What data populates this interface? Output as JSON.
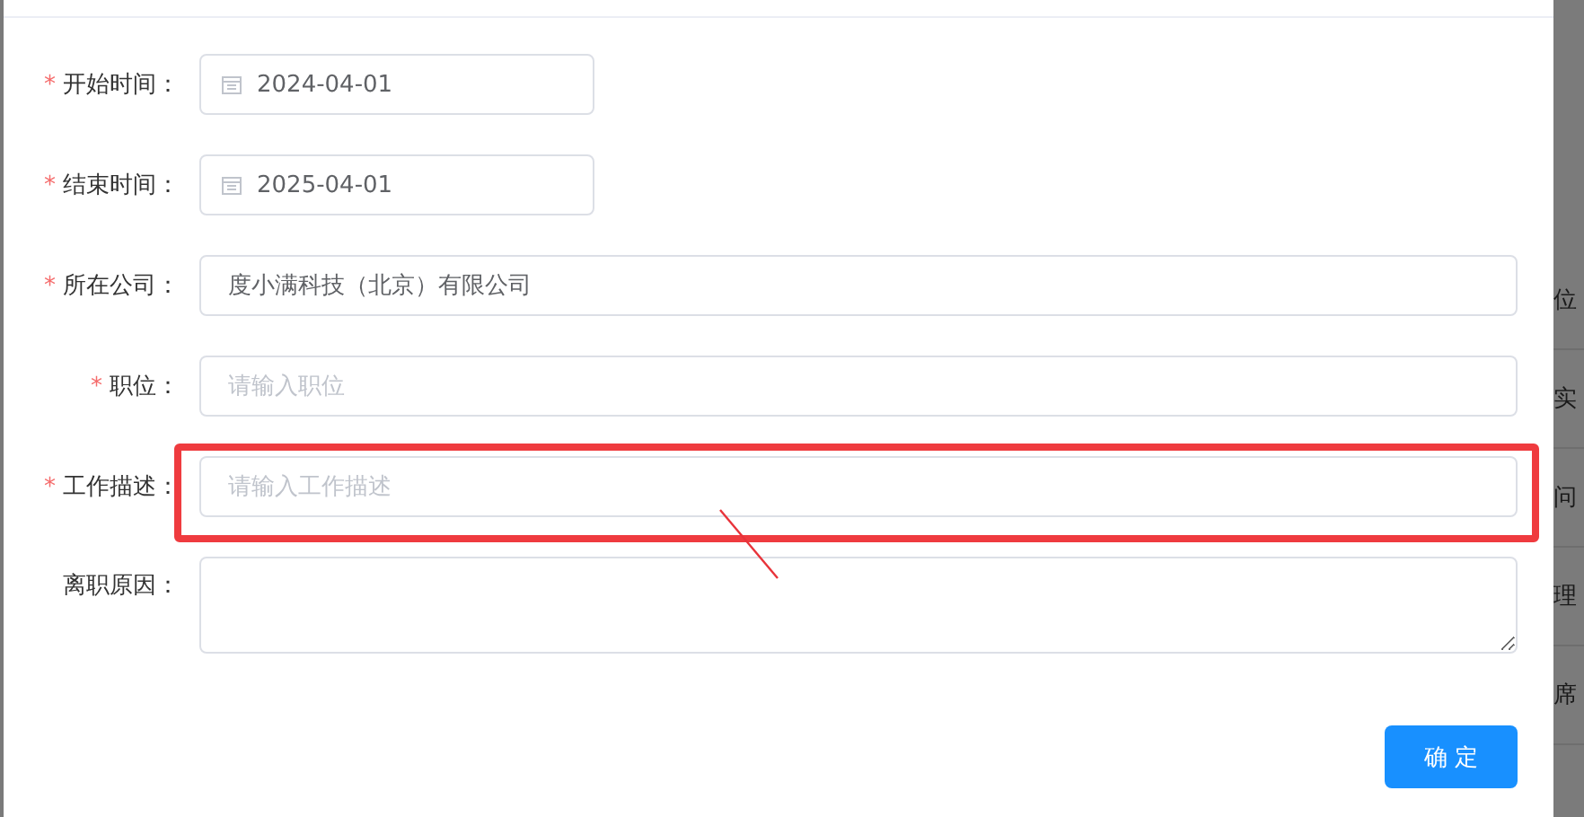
{
  "form": {
    "required_mark": "*",
    "fields": [
      {
        "kind": "date",
        "label": "开始时间：",
        "required": true,
        "value": "2024-04-01"
      },
      {
        "kind": "date",
        "label": "结束时间：",
        "required": true,
        "value": "2025-04-01"
      },
      {
        "kind": "text",
        "label": "所在公司：",
        "required": true,
        "value": "度小满科技（北京）有限公司"
      },
      {
        "kind": "text",
        "label": "职位：",
        "required": true,
        "placeholder": "请输入职位"
      },
      {
        "kind": "text",
        "label": "工作描述：",
        "required": true,
        "placeholder": "请输入工作描述",
        "highlighted": true
      },
      {
        "kind": "textarea",
        "label": "离职原因：",
        "required": false
      }
    ],
    "submit": "确 定"
  },
  "background_rows": [
    "位",
    "实",
    "问",
    "理",
    "席"
  ]
}
